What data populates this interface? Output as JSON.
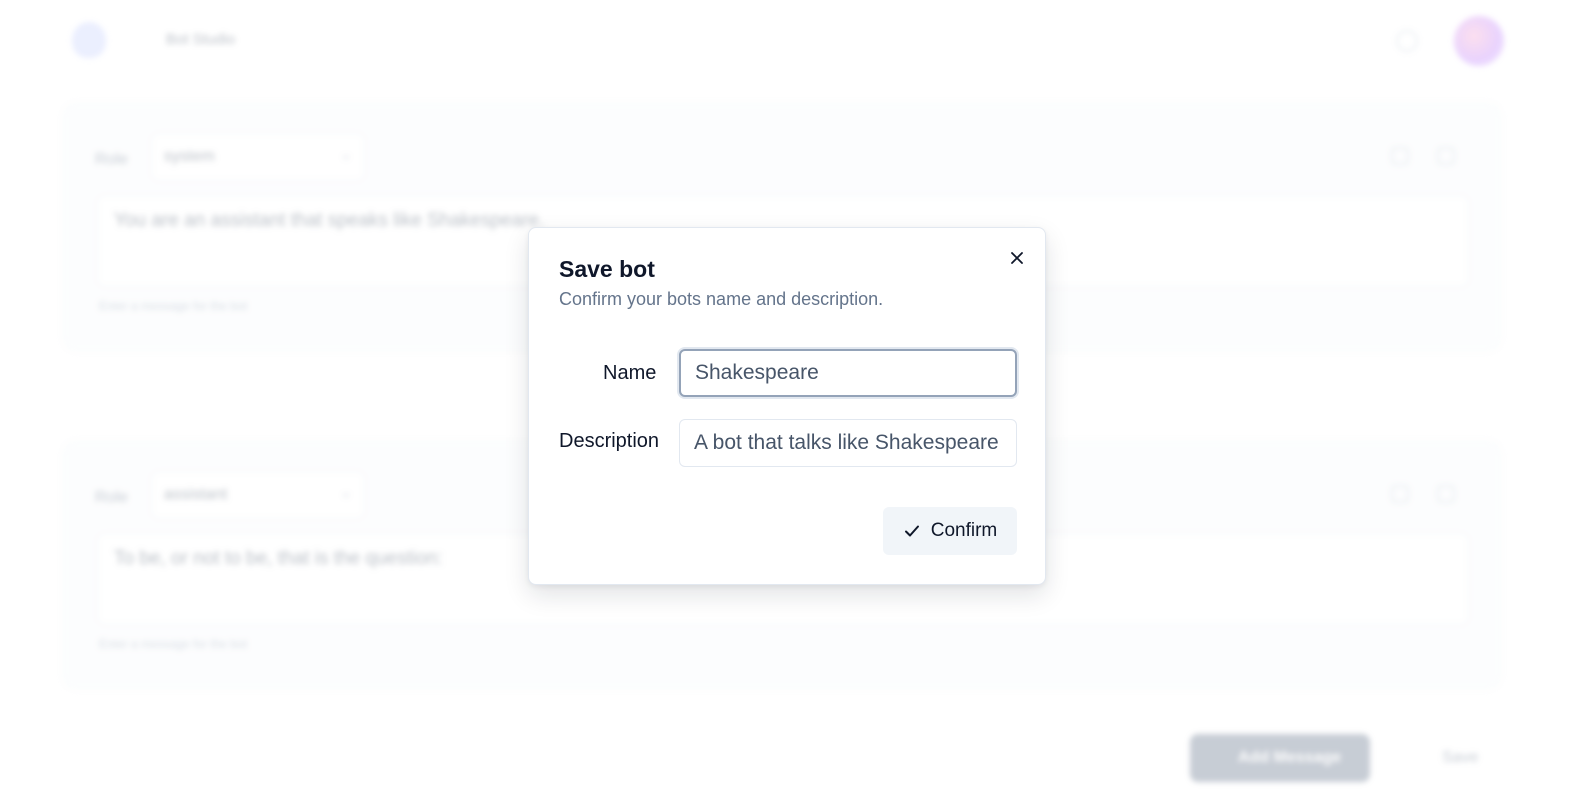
{
  "app": {
    "title": "Bot Studio"
  },
  "messages": [
    {
      "role_label": "Role",
      "role": "system",
      "content": "You are an assistant that speaks like Shakespeare.",
      "hint": "Enter a message for the bot"
    },
    {
      "role_label": "Role",
      "role": "assistant",
      "content": "To be, or not to be, that is the question:",
      "hint": "Enter a message for the bot"
    }
  ],
  "footer": {
    "add_message_label": "Add Message",
    "save_label": "Save"
  },
  "dialog": {
    "title": "Save bot",
    "description": "Confirm your bots name and description.",
    "name_label": "Name",
    "name_value": "Shakespeare",
    "description_label": "Description",
    "description_value": "A bot that talks like Shakespeare",
    "confirm_label": "Confirm"
  },
  "icons": {
    "close": "close-icon",
    "confirm": "check-icon"
  }
}
